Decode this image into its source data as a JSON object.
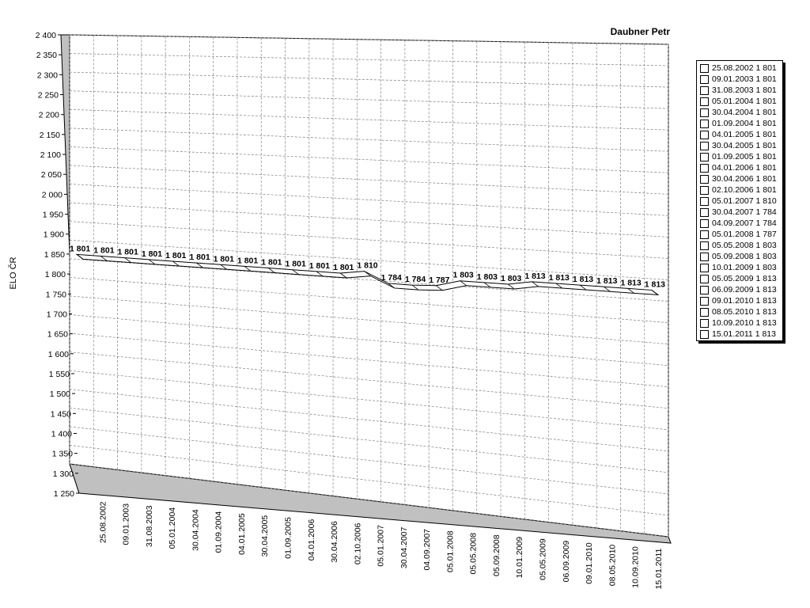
{
  "chart_data": {
    "type": "line",
    "title": "Daubner Petr",
    "ylabel": "ELO ČR",
    "xlabel": "",
    "ylim": [
      1250,
      2400
    ],
    "y_ticks": [
      "2 400",
      "2 350",
      "2 300",
      "2 250",
      "2 200",
      "2 150",
      "2 100",
      "2 050",
      "2 000",
      "1 950",
      "1 900",
      "1 850",
      "1 800",
      "1 750",
      "1 700",
      "1 650",
      "1 600",
      "1 550",
      "1 500",
      "1 450",
      "1 400",
      "1 350",
      "1 300",
      "1 250"
    ],
    "grid": true,
    "legend_position": "right",
    "categories": [
      "25.08.2002",
      "09.01.2003",
      "31.08.2003",
      "05.01.2004",
      "30.04.2004",
      "01.09.2004",
      "04.01.2005",
      "30.04.2005",
      "01.09.2005",
      "04.01.2006",
      "30.04.2006",
      "02.10.2006",
      "05.01.2007",
      "30.04.2007",
      "04.09.2007",
      "05.01.2008",
      "05.05.2008",
      "05.09.2008",
      "10.01.2009",
      "05.05.2009",
      "06.09.2009",
      "09.01.2010",
      "08.05.2010",
      "10.09.2010",
      "15.01.2011"
    ],
    "series": [
      {
        "values": [
          1801,
          1801,
          1801,
          1801,
          1801,
          1801,
          1801,
          1801,
          1801,
          1801,
          1801,
          1801,
          1810,
          1784,
          1784,
          1787,
          1803,
          1803,
          1803,
          1813,
          1813,
          1813,
          1813,
          1813,
          1813
        ],
        "data_labels": [
          "1 801",
          "1 801",
          "1 801",
          "1 801",
          "1 801",
          "1 801",
          "1 801",
          "1 801",
          "1 801",
          "1 801",
          "1 801",
          "1 801",
          "1 810",
          "1 784",
          "1 784",
          "1 787",
          "1 803",
          "1 803",
          "1 803",
          "1 813",
          "1 813",
          "1 813",
          "1 813",
          "1 813",
          "1 813"
        ]
      }
    ],
    "legend_entries": [
      "25.08.2002 1 801",
      "09.01.2003 1 801",
      "31.08.2003 1 801",
      "05.01.2004 1 801",
      "30.04.2004 1 801",
      "01.09.2004 1 801",
      "04.01.2005 1 801",
      "30.04.2005 1 801",
      "01.09.2005 1 801",
      "04.01.2006 1 801",
      "30.04.2006 1 801",
      "02.10.2006 1 801",
      "05.01.2007 1 810",
      "30.04.2007 1 784",
      "04.09.2007 1 784",
      "05.01.2008 1 787",
      "05.05.2008 1 803",
      "05.09.2008 1 803",
      "10.01.2009 1 803",
      "05.05.2009 1 813",
      "06.09.2009 1 813",
      "09.01.2010 1 813",
      "08.05.2010 1 813",
      "10.09.2010 1 813",
      "15.01.2011 1 813"
    ],
    "colors": {
      "line_fill": "#ffffff",
      "line_stroke": "#000000",
      "wall": "#c0c0c0",
      "grid": "#808080"
    }
  }
}
